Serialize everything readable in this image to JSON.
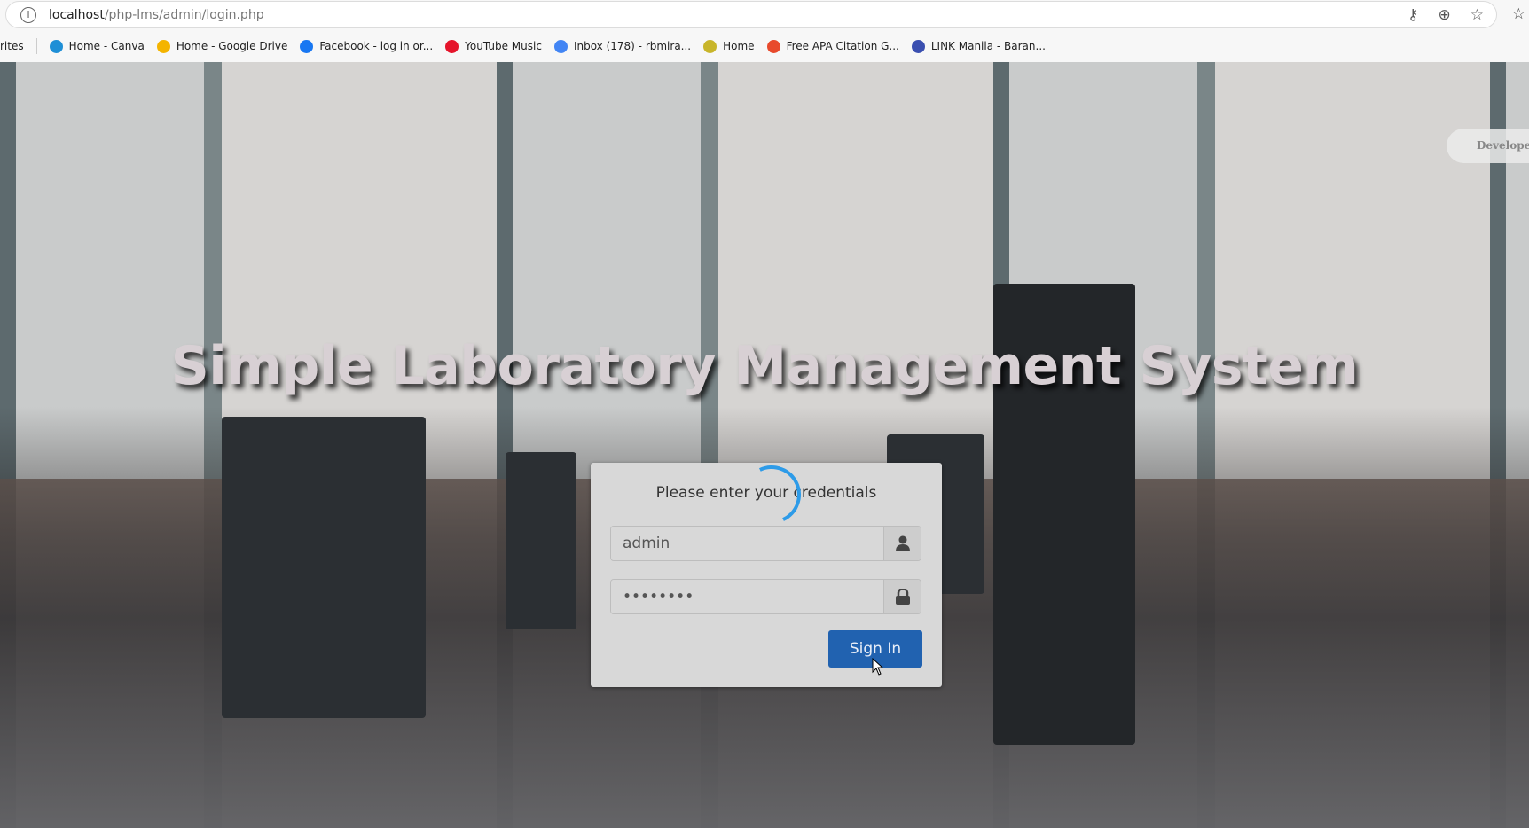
{
  "browser": {
    "url_host": "localhost",
    "url_path": "/php-lms/admin/login.php",
    "bookmarks_partial": "rites",
    "bookmarks": [
      {
        "label": "Home - Canva",
        "icon": "canva-icon",
        "color": "#1f8fd6"
      },
      {
        "label": "Home - Google Drive",
        "icon": "google-drive-icon",
        "color": "#f4b400"
      },
      {
        "label": "Facebook - log in or...",
        "icon": "facebook-icon",
        "color": "#1877f2"
      },
      {
        "label": "YouTube Music",
        "icon": "youtube-music-icon",
        "color": "#e5142b"
      },
      {
        "label": "Inbox (178) - rbmira...",
        "icon": "google-icon",
        "color": "#4285f4"
      },
      {
        "label": "Home",
        "icon": "home-icon",
        "color": "#c8b52a"
      },
      {
        "label": "Free APA Citation G...",
        "icon": "citation-icon",
        "color": "#e84a2c"
      },
      {
        "label": "LINK Manila - Baran...",
        "icon": "link-manila-icon",
        "color": "#3a4fb0"
      }
    ]
  },
  "page": {
    "title": "Simple Laboratory Management System",
    "developer_tab": "Developed"
  },
  "login": {
    "message": "Please enter your credentials",
    "username": "admin",
    "password": "••••••••",
    "sign_in": "Sign In"
  },
  "colors": {
    "button": "#2162b0",
    "spinner": "#2d9be8"
  }
}
